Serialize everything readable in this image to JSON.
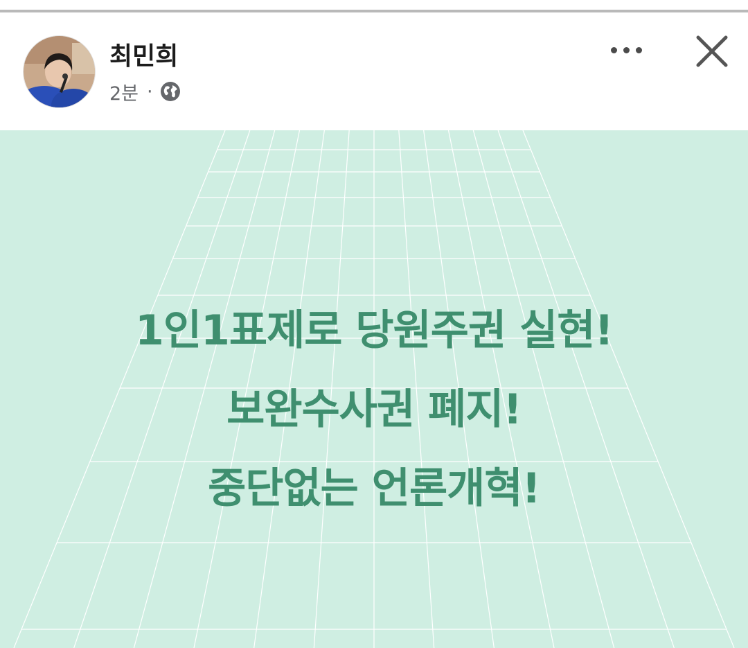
{
  "post": {
    "author": "최민희",
    "time": "2분",
    "separator": "·",
    "privacy_icon": "globe-icon",
    "more_icon": "more-horizontal-icon",
    "close_icon": "close-icon"
  },
  "image": {
    "background_color": "#cfeee2",
    "grid_color": "#ffffff",
    "text_color": "#3f8f6f",
    "lines": [
      "1인1표제로 당원주권 실현!",
      "보완수사권 폐지!",
      "중단없는 언론개혁!"
    ]
  }
}
